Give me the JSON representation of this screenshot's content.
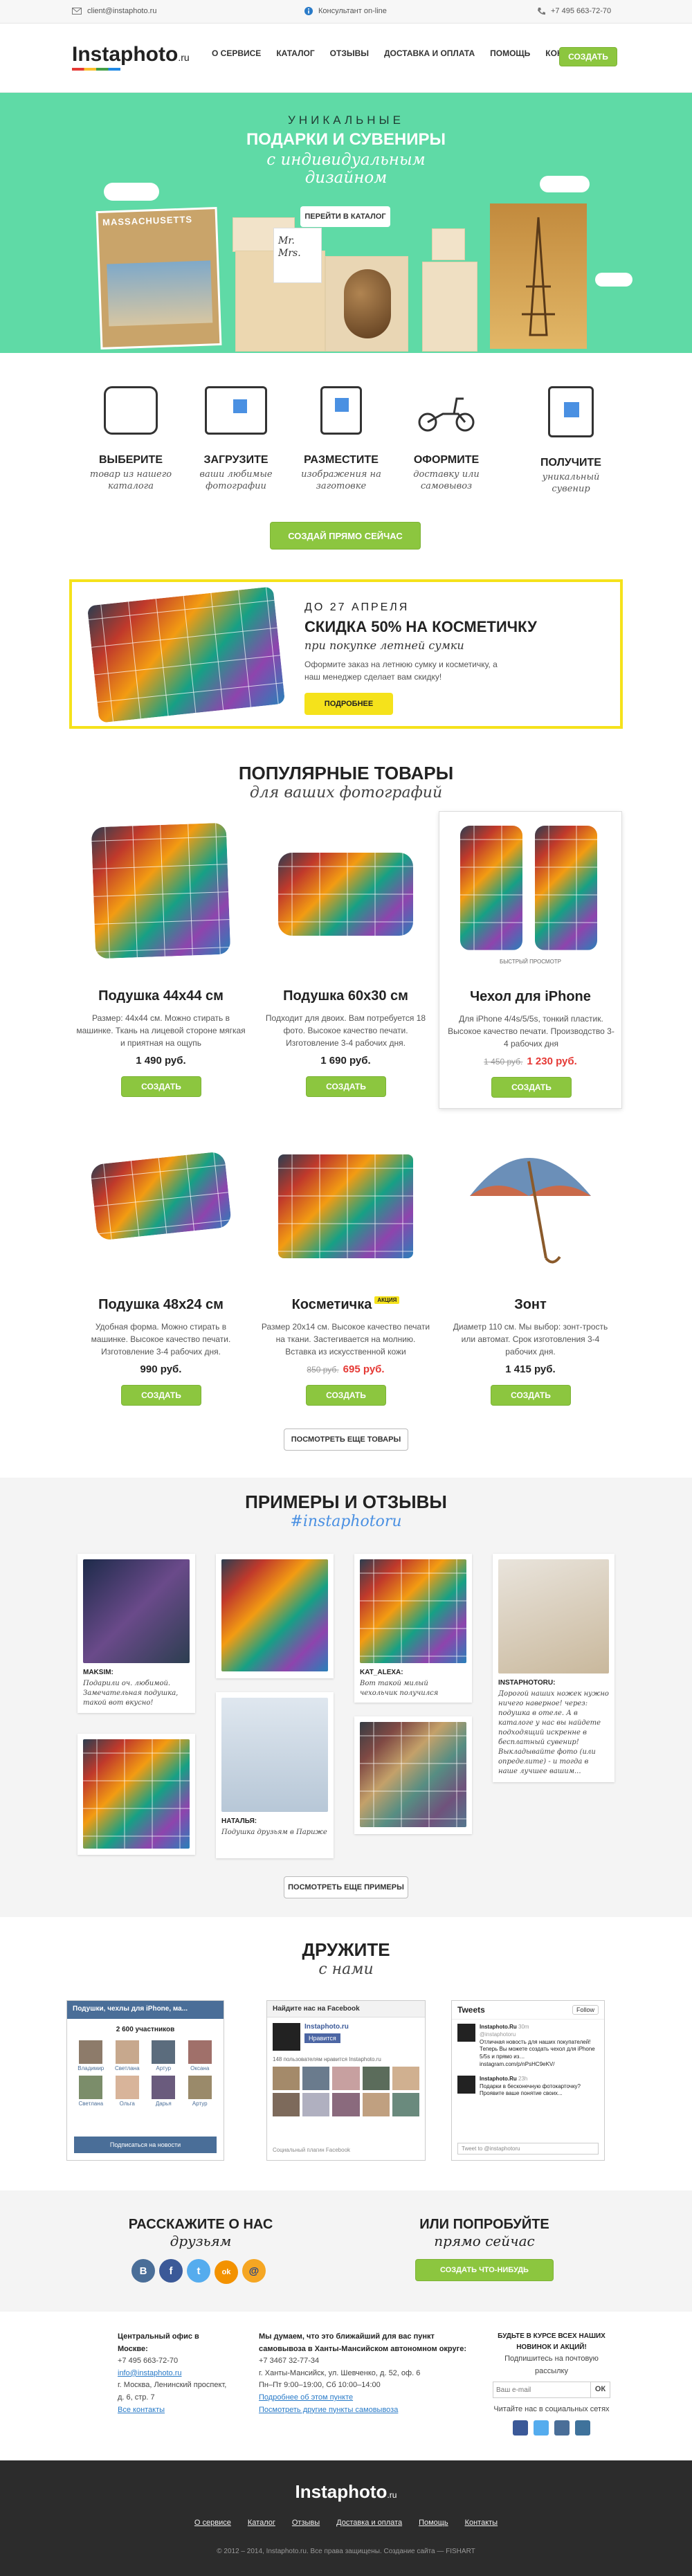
{
  "topbar": {
    "email": "client@instaphoto.ru",
    "chat": "Консультант on-line",
    "phone": "+7 495 663-72-70"
  },
  "header": {
    "logo": "Instaphoto",
    "logo_ru": ".ru",
    "nav": [
      "О сервисе",
      "Каталог",
      "Отзывы",
      "Доставка и оплата",
      "Помощь",
      "Контакты"
    ],
    "create": "Создать"
  },
  "hero": {
    "line1": "уникальные",
    "line2": "подарки и сувениры",
    "line3": "с индивидуальным",
    "line4": "дизайном",
    "cta": "Перейти в каталог",
    "postcard": "MASSACHUSETTS",
    "sign": "Mr.",
    "sign2": "Mrs."
  },
  "steps": [
    {
      "title": "Выберите",
      "desc": "товар из нашего каталога",
      "icon": "pillow-icon"
    },
    {
      "title": "Загрузите",
      "desc": "ваши любимые фотографии",
      "icon": "upload-icon"
    },
    {
      "title": "Разместите",
      "desc": "изображения на заготовке",
      "icon": "place-icon"
    },
    {
      "title": "Оформите",
      "desc": "доставку или самовывоз",
      "icon": "scooter-icon"
    },
    {
      "title": "Получите",
      "desc": "уникальный сувенир",
      "icon": "gift-icon"
    }
  ],
  "steps_cta": "Создай прямо сейчас",
  "promo": {
    "date": "до 27 апреля",
    "title": "Скидка 50% на косметичку",
    "subtitle": "при покупке летней сумки",
    "text": "Оформите заказ на летнюю сумку и косметичку, а наш менеджер сделает вам скидку!",
    "button": "Подробнее"
  },
  "popular": {
    "title": "Популярные товары",
    "subtitle": "для ваших фотографий",
    "more": "Посмотреть еще товары",
    "quickview": "Быстрый просмотр",
    "badge": "Акция"
  },
  "products": [
    {
      "name": "Подушка 44x44 см",
      "desc": "Размер: 44x44 см. Можно стирать в машинке. Ткань на лицевой стороне мягкая и приятная на ощупь",
      "old": "",
      "price": "1 490 руб.",
      "buy": "Создать"
    },
    {
      "name": "Подушка 60x30 см",
      "desc": "Подходит для двоих. Вам потребуется 18 фото. Высокое качество печати. Изготовление 3-4 рабочих дня.",
      "old": "",
      "price": "1 690 руб.",
      "buy": "Создать"
    },
    {
      "name": "Чехол для iPhone",
      "desc": "Для iPhone 4/4s/5/5s, тонкий пластик. Высокое качество печати. Производство 3-4 рабочих дня",
      "old": "1 450 руб.",
      "price": "1 230 руб.",
      "buy": "Создать"
    },
    {
      "name": "Подушка 48x24 см",
      "desc": "Удобная форма. Можно стирать в машинке. Высокое качество печати. Изготовление 3-4 рабочих дня.",
      "old": "",
      "price": "990 руб.",
      "buy": "Создать"
    },
    {
      "name": "Косметичка",
      "desc": "Размер 20x14 см. Высокое качество печати на ткани. Застегивается на молнию. Вставка из искусственной кожи",
      "old": "850 руб.",
      "price": "695 руб.",
      "buy": "Создать"
    },
    {
      "name": "Зонт",
      "desc": "Диаметр 110 см. Мы выбор: зонт-трость или автомат. Срок изготовления 3-4 рабочих дня.",
      "old": "",
      "price": "1 415 руб.",
      "buy": "Создать"
    }
  ],
  "reviews": {
    "title": "Примеры и отзывы",
    "tag": "#instaphotoru",
    "more": "Посмотреть еще примеры",
    "items": [
      {
        "user": "MAKSIM:",
        "text": "Подарили оч. любимой. Замечательная подушка, такой вот вкусно!"
      },
      {
        "user": "KAT_ALEXA:",
        "text": "Вот такой милый чехольчик получился"
      },
      {
        "user": "INSTAPHOTORU:",
        "text": "Дорогой наших ножек нужно ничего наверное! через: подушка в отеле. А в каталоге у нас вы найдете подходящий искренне в бесплатный сувенир! Выкладывайте фото (или определите) - и тогда в наше лучшее вашим..."
      },
      {
        "user": "НАТАЛЬЯ:",
        "text": "Подушка друзьям в Париже"
      }
    ]
  },
  "friends": {
    "title": "Дружите",
    "subtitle": "с нами",
    "vk": {
      "head": "Подушки, чехлы для iPhone, ма...",
      "count": "2 600 участников",
      "names": [
        "Владимир",
        "Светлана",
        "Артур",
        "Оксана",
        "Светлана",
        "Ольга",
        "Дарья",
        "Артур"
      ],
      "btn": "Подписаться на новости"
    },
    "fb": {
      "head": "Найдите нас на Facebook",
      "page": "Instaphoto.ru",
      "like": "Нравится",
      "likes": "148 пользователям нравится Instaphoto.ru",
      "plugin": "Социальный плагин Facebook"
    },
    "tw": {
      "head": "Tweets",
      "follow": "Follow",
      "t1user": "Instaphoto.Ru",
      "t1handle": "@instaphotoru",
      "t1time": "30m",
      "t1": "Отличная новость для наших покупателей! Теперь Вы можете создать чехол для iPhone 5/5s и прямо из… instagram.com/p/nPsHC9eKV/",
      "t2time": "23h",
      "t2": "Подарки в бесконечную фотокарточку? Проявите ваше понятие своих...",
      "input": "Tweet to @instaphotoru"
    }
  },
  "share": {
    "left1": "Расскажите о нас",
    "left2": "друзьям",
    "right1": "или попробуйте",
    "right2": "прямо сейчас",
    "btn": "Создать что-нибудь",
    "icons": [
      "В",
      "f",
      "t",
      "ok",
      "@"
    ]
  },
  "foot_info": {
    "c1title": "Центральный офис в Москве:",
    "c1phone": "+7 495 663-72-70",
    "c1mail": "info@instaphoto.ru",
    "c1addr": "г. Москва, Ленинский проспект, д. 6, стр. 7",
    "c1link": "Все контакты",
    "c2title": "Мы думаем, что это ближайший для вас пункт самовывоза в Ханты-Мансийском автономном округе:",
    "c2phone": "+7 3467 32-77-34",
    "c2addr": "г. Ханты-Мансийск, ул. Шевченко, д. 52, оф. 6",
    "c2hours": "Пн–Пт 9:00–19:00, Сб 10:00–14:00",
    "c2link1": "Подробнее об этом пункте",
    "c2link2": "Посмотреть другие пункты самовывоза",
    "c3title": "Будьте в курсе всех наших новинок и акций!",
    "c3sub": "Подпишитесь на почтовую рассылку",
    "c3ph": "Ваш e-mail",
    "c3btn": "ОК",
    "c3soc": "Читайте нас в социальных сетях"
  },
  "footer": {
    "logo": "Instaphoto",
    "logo_ru": ".ru",
    "nav": [
      "О сервисе",
      "Каталог",
      "Отзывы",
      "Доставка и оплата",
      "Помощь",
      "Контакты"
    ],
    "copy": "© 2012 – 2014, Instaphoto.ru. Все права защищены. Создание сайта — FISHART"
  },
  "colors": {
    "green": "#8cc63f",
    "mint": "#5fdaa6",
    "yellow": "#f5e21b",
    "red": "#e53935",
    "link": "#2a7bc8"
  }
}
